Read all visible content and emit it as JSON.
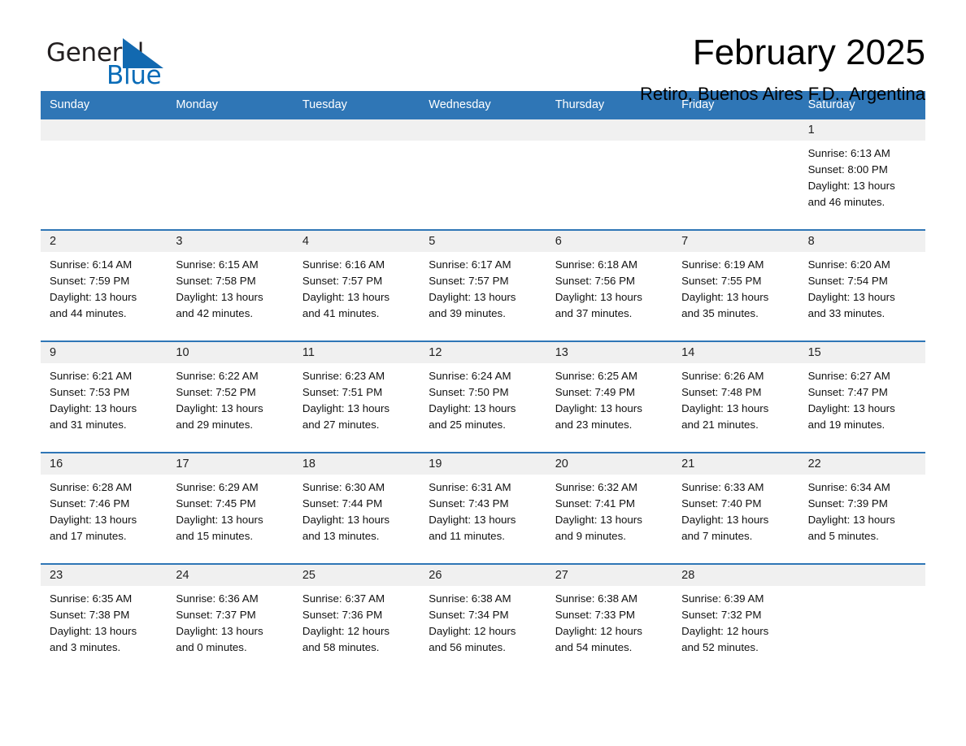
{
  "brand": {
    "name_part1": "General",
    "name_part2": "Blue",
    "triangle_color": "#1269b0",
    "text_color": "#231f20",
    "blue_text_color": "#0a6cb8"
  },
  "header": {
    "month_title": "February 2025",
    "location": "Retiro, Buenos Aires F.D., Argentina",
    "header_bg_color": "#2f76b6",
    "day_band_color": "#f0f0f0"
  },
  "weekdays": [
    "Sunday",
    "Monday",
    "Tuesday",
    "Wednesday",
    "Thursday",
    "Friday",
    "Saturday"
  ],
  "weeks": [
    [
      {
        "day": "",
        "empty": true,
        "sunrise": "",
        "sunset": "",
        "daylight_line1": "",
        "daylight_line2": ""
      },
      {
        "day": "",
        "empty": true,
        "sunrise": "",
        "sunset": "",
        "daylight_line1": "",
        "daylight_line2": ""
      },
      {
        "day": "",
        "empty": true,
        "sunrise": "",
        "sunset": "",
        "daylight_line1": "",
        "daylight_line2": ""
      },
      {
        "day": "",
        "empty": true,
        "sunrise": "",
        "sunset": "",
        "daylight_line1": "",
        "daylight_line2": ""
      },
      {
        "day": "",
        "empty": true,
        "sunrise": "",
        "sunset": "",
        "daylight_line1": "",
        "daylight_line2": ""
      },
      {
        "day": "",
        "empty": true,
        "sunrise": "",
        "sunset": "",
        "daylight_line1": "",
        "daylight_line2": ""
      },
      {
        "day": "1",
        "empty": false,
        "sunrise": "Sunrise: 6:13 AM",
        "sunset": "Sunset: 8:00 PM",
        "daylight_line1": "Daylight: 13 hours",
        "daylight_line2": "and 46 minutes."
      }
    ],
    [
      {
        "day": "2",
        "empty": false,
        "sunrise": "Sunrise: 6:14 AM",
        "sunset": "Sunset: 7:59 PM",
        "daylight_line1": "Daylight: 13 hours",
        "daylight_line2": "and 44 minutes."
      },
      {
        "day": "3",
        "empty": false,
        "sunrise": "Sunrise: 6:15 AM",
        "sunset": "Sunset: 7:58 PM",
        "daylight_line1": "Daylight: 13 hours",
        "daylight_line2": "and 42 minutes."
      },
      {
        "day": "4",
        "empty": false,
        "sunrise": "Sunrise: 6:16 AM",
        "sunset": "Sunset: 7:57 PM",
        "daylight_line1": "Daylight: 13 hours",
        "daylight_line2": "and 41 minutes."
      },
      {
        "day": "5",
        "empty": false,
        "sunrise": "Sunrise: 6:17 AM",
        "sunset": "Sunset: 7:57 PM",
        "daylight_line1": "Daylight: 13 hours",
        "daylight_line2": "and 39 minutes."
      },
      {
        "day": "6",
        "empty": false,
        "sunrise": "Sunrise: 6:18 AM",
        "sunset": "Sunset: 7:56 PM",
        "daylight_line1": "Daylight: 13 hours",
        "daylight_line2": "and 37 minutes."
      },
      {
        "day": "7",
        "empty": false,
        "sunrise": "Sunrise: 6:19 AM",
        "sunset": "Sunset: 7:55 PM",
        "daylight_line1": "Daylight: 13 hours",
        "daylight_line2": "and 35 minutes."
      },
      {
        "day": "8",
        "empty": false,
        "sunrise": "Sunrise: 6:20 AM",
        "sunset": "Sunset: 7:54 PM",
        "daylight_line1": "Daylight: 13 hours",
        "daylight_line2": "and 33 minutes."
      }
    ],
    [
      {
        "day": "9",
        "empty": false,
        "sunrise": "Sunrise: 6:21 AM",
        "sunset": "Sunset: 7:53 PM",
        "daylight_line1": "Daylight: 13 hours",
        "daylight_line2": "and 31 minutes."
      },
      {
        "day": "10",
        "empty": false,
        "sunrise": "Sunrise: 6:22 AM",
        "sunset": "Sunset: 7:52 PM",
        "daylight_line1": "Daylight: 13 hours",
        "daylight_line2": "and 29 minutes."
      },
      {
        "day": "11",
        "empty": false,
        "sunrise": "Sunrise: 6:23 AM",
        "sunset": "Sunset: 7:51 PM",
        "daylight_line1": "Daylight: 13 hours",
        "daylight_line2": "and 27 minutes."
      },
      {
        "day": "12",
        "empty": false,
        "sunrise": "Sunrise: 6:24 AM",
        "sunset": "Sunset: 7:50 PM",
        "daylight_line1": "Daylight: 13 hours",
        "daylight_line2": "and 25 minutes."
      },
      {
        "day": "13",
        "empty": false,
        "sunrise": "Sunrise: 6:25 AM",
        "sunset": "Sunset: 7:49 PM",
        "daylight_line1": "Daylight: 13 hours",
        "daylight_line2": "and 23 minutes."
      },
      {
        "day": "14",
        "empty": false,
        "sunrise": "Sunrise: 6:26 AM",
        "sunset": "Sunset: 7:48 PM",
        "daylight_line1": "Daylight: 13 hours",
        "daylight_line2": "and 21 minutes."
      },
      {
        "day": "15",
        "empty": false,
        "sunrise": "Sunrise: 6:27 AM",
        "sunset": "Sunset: 7:47 PM",
        "daylight_line1": "Daylight: 13 hours",
        "daylight_line2": "and 19 minutes."
      }
    ],
    [
      {
        "day": "16",
        "empty": false,
        "sunrise": "Sunrise: 6:28 AM",
        "sunset": "Sunset: 7:46 PM",
        "daylight_line1": "Daylight: 13 hours",
        "daylight_line2": "and 17 minutes."
      },
      {
        "day": "17",
        "empty": false,
        "sunrise": "Sunrise: 6:29 AM",
        "sunset": "Sunset: 7:45 PM",
        "daylight_line1": "Daylight: 13 hours",
        "daylight_line2": "and 15 minutes."
      },
      {
        "day": "18",
        "empty": false,
        "sunrise": "Sunrise: 6:30 AM",
        "sunset": "Sunset: 7:44 PM",
        "daylight_line1": "Daylight: 13 hours",
        "daylight_line2": "and 13 minutes."
      },
      {
        "day": "19",
        "empty": false,
        "sunrise": "Sunrise: 6:31 AM",
        "sunset": "Sunset: 7:43 PM",
        "daylight_line1": "Daylight: 13 hours",
        "daylight_line2": "and 11 minutes."
      },
      {
        "day": "20",
        "empty": false,
        "sunrise": "Sunrise: 6:32 AM",
        "sunset": "Sunset: 7:41 PM",
        "daylight_line1": "Daylight: 13 hours",
        "daylight_line2": "and 9 minutes."
      },
      {
        "day": "21",
        "empty": false,
        "sunrise": "Sunrise: 6:33 AM",
        "sunset": "Sunset: 7:40 PM",
        "daylight_line1": "Daylight: 13 hours",
        "daylight_line2": "and 7 minutes."
      },
      {
        "day": "22",
        "empty": false,
        "sunrise": "Sunrise: 6:34 AM",
        "sunset": "Sunset: 7:39 PM",
        "daylight_line1": "Daylight: 13 hours",
        "daylight_line2": "and 5 minutes."
      }
    ],
    [
      {
        "day": "23",
        "empty": false,
        "sunrise": "Sunrise: 6:35 AM",
        "sunset": "Sunset: 7:38 PM",
        "daylight_line1": "Daylight: 13 hours",
        "daylight_line2": "and 3 minutes."
      },
      {
        "day": "24",
        "empty": false,
        "sunrise": "Sunrise: 6:36 AM",
        "sunset": "Sunset: 7:37 PM",
        "daylight_line1": "Daylight: 13 hours",
        "daylight_line2": "and 0 minutes."
      },
      {
        "day": "25",
        "empty": false,
        "sunrise": "Sunrise: 6:37 AM",
        "sunset": "Sunset: 7:36 PM",
        "daylight_line1": "Daylight: 12 hours",
        "daylight_line2": "and 58 minutes."
      },
      {
        "day": "26",
        "empty": false,
        "sunrise": "Sunrise: 6:38 AM",
        "sunset": "Sunset: 7:34 PM",
        "daylight_line1": "Daylight: 12 hours",
        "daylight_line2": "and 56 minutes."
      },
      {
        "day": "27",
        "empty": false,
        "sunrise": "Sunrise: 6:38 AM",
        "sunset": "Sunset: 7:33 PM",
        "daylight_line1": "Daylight: 12 hours",
        "daylight_line2": "and 54 minutes."
      },
      {
        "day": "28",
        "empty": false,
        "sunrise": "Sunrise: 6:39 AM",
        "sunset": "Sunset: 7:32 PM",
        "daylight_line1": "Daylight: 12 hours",
        "daylight_line2": "and 52 minutes."
      },
      {
        "day": "",
        "empty": true,
        "sunrise": "",
        "sunset": "",
        "daylight_line1": "",
        "daylight_line2": ""
      }
    ]
  ]
}
